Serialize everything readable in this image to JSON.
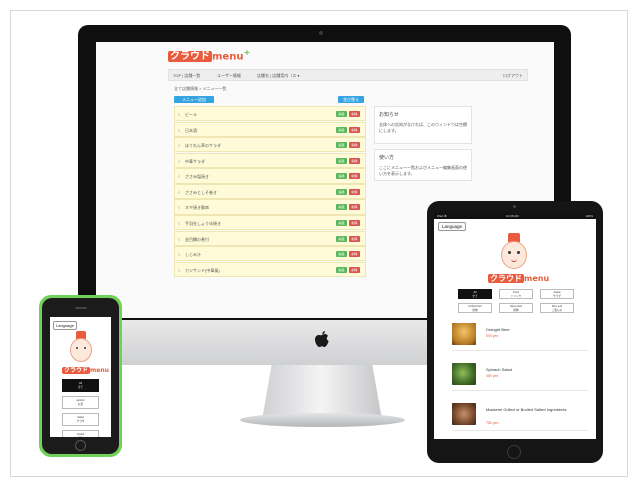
{
  "desktop": {
    "logo": {
      "kata": "クラウド",
      "eng": "menu",
      "plus": "+"
    },
    "nav": {
      "items": [
        "TOP | 店舗一覧",
        "ユーザー情報",
        "店舗名 | 店舗案内（ス ▾"
      ],
      "right": "ログアウト"
    },
    "breadcrumb": "全て店舗情報 > メニュー一覧",
    "add_button": "メニュー追加",
    "sort_button": "並び替え",
    "edit_label": "編集",
    "delete_label": "削除",
    "menu_items": [
      "ビール",
      "日本酒",
      "ほうれん草のサラダ",
      "中華サラダ",
      "ささみ塩焼き",
      "ささみとしそ巻き",
      "ネギ焼き豚串",
      "手羽先しょうゆ焼き",
      "金目鯛の煮付",
      "しじみ汁",
      "カツサンド(中華風)"
    ],
    "panels": [
      {
        "title": "お知らせ",
        "body": "全体への告知がなければ、このウィンドウは空欄にします。"
      },
      {
        "title": "使い方",
        "body": "ここにメニュー一覧およびメニュー編集画面の使い方を表示します。"
      }
    ]
  },
  "tablet": {
    "status": {
      "left": "iPad ⌘",
      "center": "10:38 AM",
      "right": "100%"
    },
    "language_button": "Language",
    "logo": {
      "kata": "クラウド",
      "eng": "menu"
    },
    "categories": [
      {
        "en": "All",
        "ja": "全て",
        "active": true
      },
      {
        "en": "Drink",
        "ja": "ドリンク",
        "active": false
      },
      {
        "en": "Salad",
        "ja": "サラダ",
        "active": false
      },
      {
        "en": "Grilled Dish",
        "ja": "焼物",
        "active": false
      },
      {
        "en": "Deep-fried",
        "ja": "揚物",
        "active": false
      },
      {
        "en": "Rice and",
        "ja": "ご飯もの",
        "active": false
      }
    ],
    "items": [
      {
        "name": "Draught Beer",
        "price": "500 yen",
        "color": "#c98b2a"
      },
      {
        "name": "Spinach Salad",
        "price": "480 yen",
        "color": "#4f7a34"
      },
      {
        "name": "Mackerel Grilled or Broiled Salted Ingredients",
        "price": "780 yen",
        "color": "#8a5a3c"
      }
    ]
  },
  "phone": {
    "language_button": "Language",
    "logo": {
      "kata": "クラウド",
      "eng": "menu"
    },
    "buttons": [
      {
        "en": "All",
        "ja": "全て",
        "active": true
      },
      {
        "en": "alcohol",
        "ja": "お酒",
        "active": false
      },
      {
        "en": "Salad",
        "ja": "サラダ",
        "active": false
      },
      {
        "en": "Grilled",
        "ja": "焼物",
        "active": false
      }
    ]
  },
  "colors": {
    "brand": "#e85b3c",
    "accent": "#6cc04a",
    "primary_button": "#35a4e0"
  }
}
